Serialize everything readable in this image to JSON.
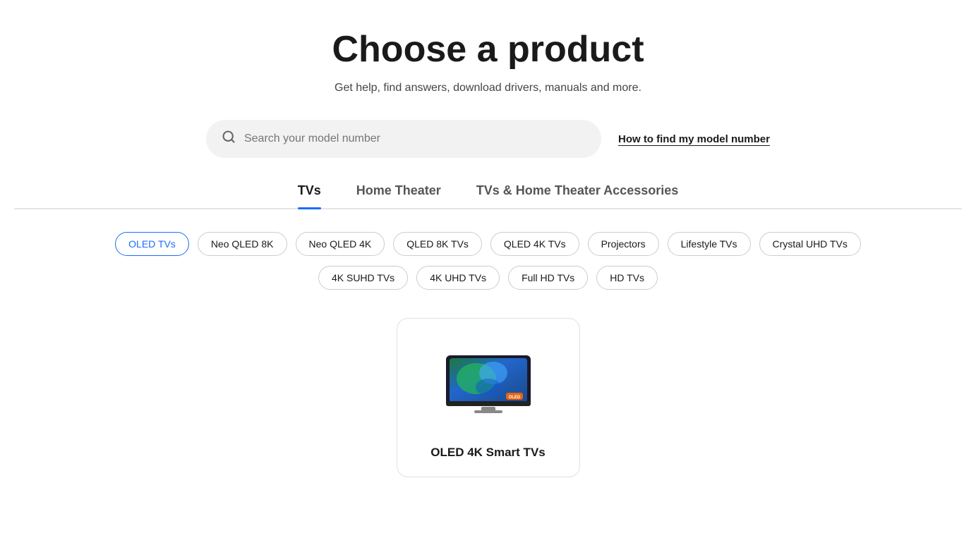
{
  "page": {
    "title": "Choose a product",
    "subtitle": "Get help, find answers, download drivers, manuals and more."
  },
  "search": {
    "placeholder": "Search your model number",
    "help_link": "How to find my model number"
  },
  "tabs": [
    {
      "id": "tvs",
      "label": "TVs",
      "active": true
    },
    {
      "id": "home-theater",
      "label": "Home Theater",
      "active": false
    },
    {
      "id": "accessories",
      "label": "TVs & Home Theater Accessories",
      "active": false
    }
  ],
  "filters_row1": [
    {
      "id": "oled-tvs",
      "label": "OLED TVs",
      "active": true
    },
    {
      "id": "neo-qled-8k",
      "label": "Neo QLED 8K",
      "active": false
    },
    {
      "id": "neo-qled-4k",
      "label": "Neo QLED 4K",
      "active": false
    },
    {
      "id": "qled-8k-tvs",
      "label": "QLED 8K TVs",
      "active": false
    },
    {
      "id": "qled-4k-tvs",
      "label": "QLED 4K TVs",
      "active": false
    },
    {
      "id": "projectors",
      "label": "Projectors",
      "active": false
    },
    {
      "id": "lifestyle-tvs",
      "label": "Lifestyle TVs",
      "active": false
    },
    {
      "id": "crystal-uhd-tvs",
      "label": "Crystal UHD TVs",
      "active": false
    }
  ],
  "filters_row2": [
    {
      "id": "4k-suhd-tvs",
      "label": "4K SUHD TVs",
      "active": false
    },
    {
      "id": "4k-uhd-tvs",
      "label": "4K UHD TVs",
      "active": false
    },
    {
      "id": "full-hd-tvs",
      "label": "Full HD TVs",
      "active": false
    },
    {
      "id": "hd-tvs",
      "label": "HD TVs",
      "active": false
    }
  ],
  "product_card": {
    "label": "OLED 4K Smart TVs",
    "image_alt": "OLED 4K Smart TV"
  },
  "colors": {
    "accent": "#1a6dff"
  }
}
